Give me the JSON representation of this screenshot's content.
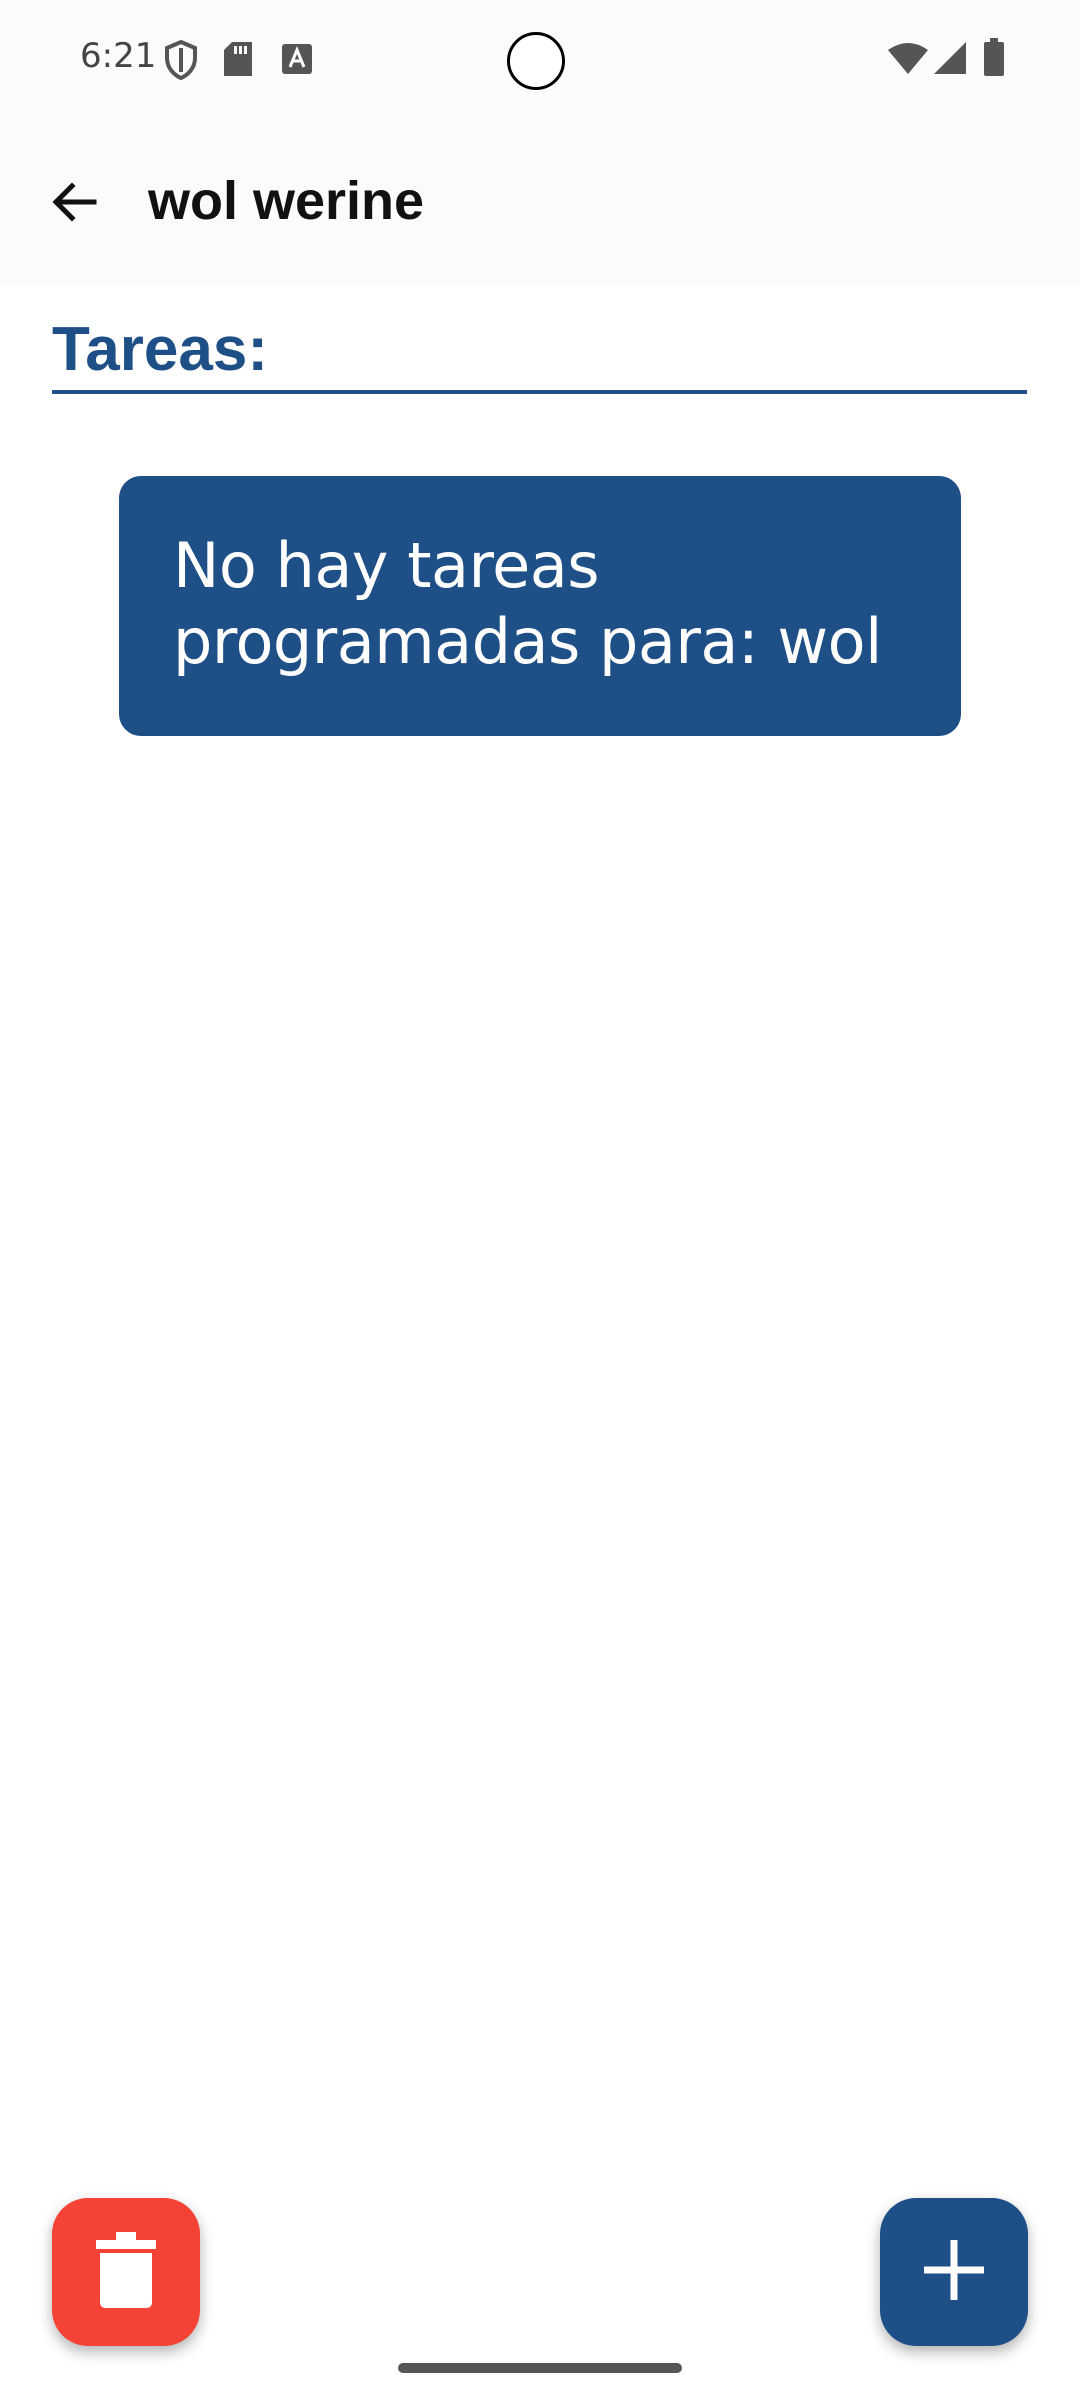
{
  "status_bar": {
    "time": "6:21",
    "left_icons": [
      "shield-icon",
      "sd-card-icon",
      "font-a-icon"
    ],
    "right_icons": [
      "wifi-icon",
      "cell-signal-icon",
      "battery-icon"
    ]
  },
  "app_bar": {
    "back_icon": "arrow-left-icon",
    "title": "wol werine"
  },
  "section": {
    "title": "Tareas:"
  },
  "empty_state": {
    "message": "No hay tareas programadas para: wol"
  },
  "actions": {
    "delete_icon": "trash-icon",
    "add_icon": "plus-icon"
  },
  "colors": {
    "primary": "#1e4f86",
    "danger": "#f44336",
    "background": "#ffffff",
    "app_bar": "#fbfbfb"
  }
}
